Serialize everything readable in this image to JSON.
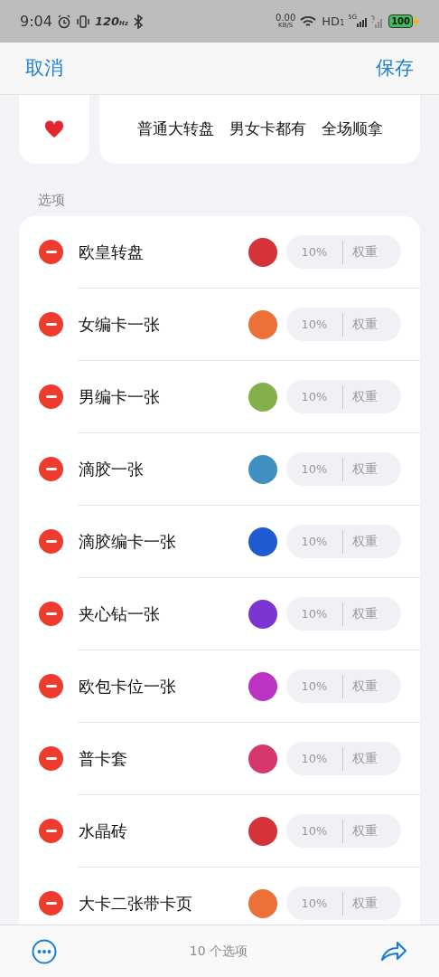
{
  "status_bar": {
    "time": "9:04",
    "refresh": "120",
    "refresh_unit": "Hz",
    "speed": "0.00",
    "speed_unit": "KB/S",
    "network": "HD",
    "network_sub": "1",
    "signal_label": "5G",
    "battery": "100"
  },
  "nav": {
    "cancel": "取消",
    "save": "保存"
  },
  "header": {
    "title": "普通大转盘　男女卡都有　全场顺拿"
  },
  "section_label": "选项",
  "options": [
    {
      "name": "欧皇转盘",
      "color": "#d63338",
      "percent": "10%",
      "placeholder": "权重"
    },
    {
      "name": "女编卡一张",
      "color": "#eb703a",
      "percent": "10%",
      "placeholder": "权重"
    },
    {
      "name": "男编卡一张",
      "color": "#83b04a",
      "percent": "10%",
      "placeholder": "权重"
    },
    {
      "name": "滴胶一张",
      "color": "#3f8fc0",
      "percent": "10%",
      "placeholder": "权重"
    },
    {
      "name": "滴胶编卡一张",
      "color": "#1f5bd0",
      "percent": "10%",
      "placeholder": "权重"
    },
    {
      "name": "夹心钻一张",
      "color": "#7b35d0",
      "percent": "10%",
      "placeholder": "权重"
    },
    {
      "name": "欧包卡位一张",
      "color": "#bc33c4",
      "percent": "10%",
      "placeholder": "权重"
    },
    {
      "name": "普卡套",
      "color": "#d6386e",
      "percent": "10%",
      "placeholder": "权重"
    },
    {
      "name": "水晶砖",
      "color": "#d63338",
      "percent": "10%",
      "placeholder": "权重"
    },
    {
      "name": "大卡二张带卡页",
      "color": "#eb703a",
      "percent": "10%",
      "placeholder": "权重"
    }
  ],
  "footer": {
    "count": "10 个选项"
  }
}
